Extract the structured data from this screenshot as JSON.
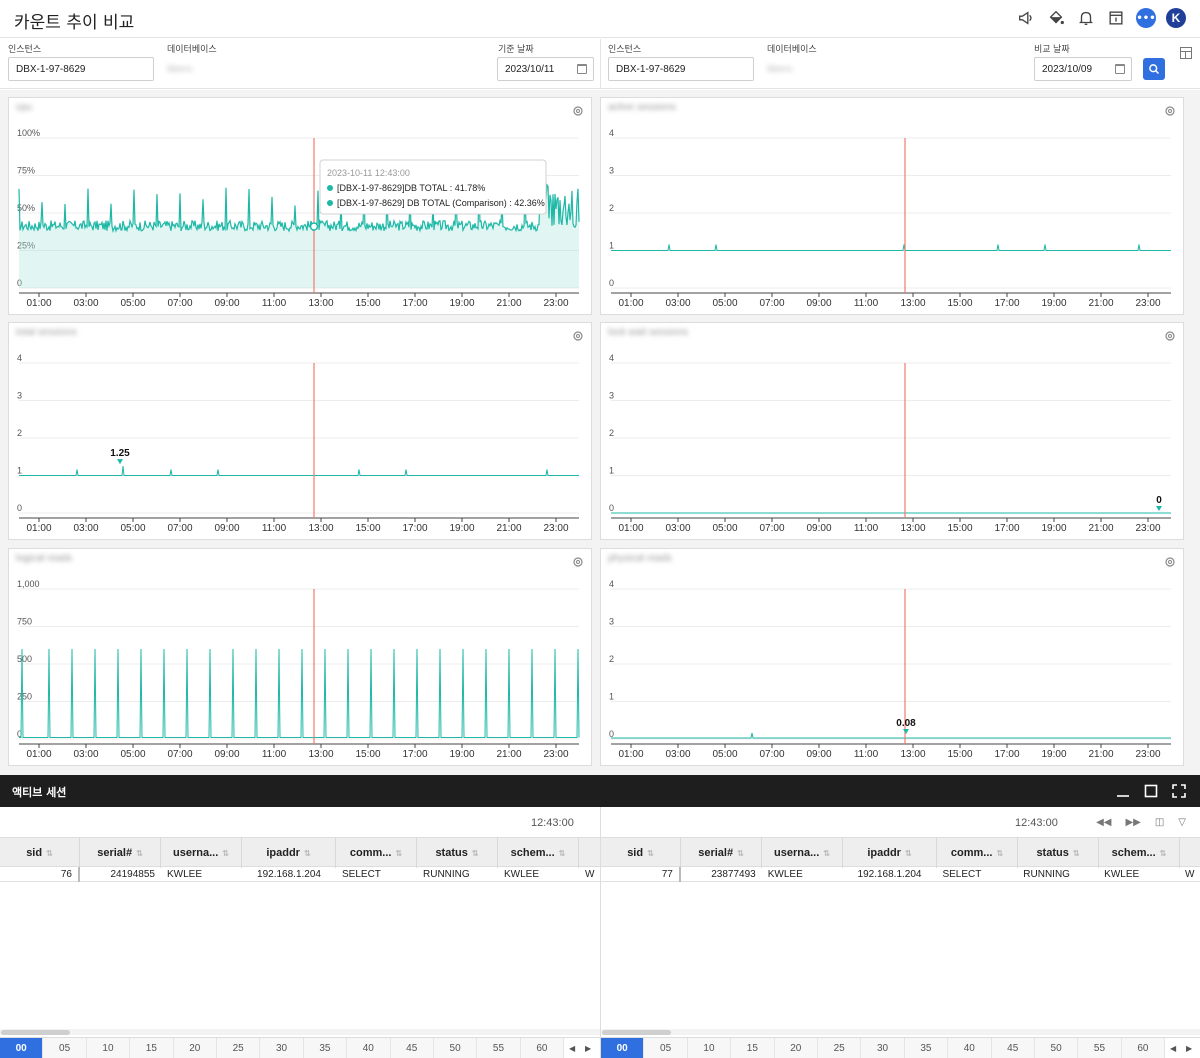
{
  "page": {
    "title": "카운트 추이 비교"
  },
  "colors": {
    "accent": "#2f6fe0",
    "series": "#1fb8a6",
    "series_light": "#a8e4dc",
    "marker": "#f47a70"
  },
  "top_icons": [
    "megaphone-icon",
    "paint-bucket-icon",
    "bell-icon",
    "info-icon",
    "chat-icon",
    "avatar"
  ],
  "avatar_letter": "K",
  "chat_glyph": "•••",
  "filters": {
    "left": {
      "instance_label": "인스턴스",
      "instance_value": "DBX-1-97-8629",
      "database_label": "데이터베이스",
      "database_value": "tibero",
      "date_label": "기준 날짜",
      "date_value": "2023/10/11"
    },
    "right": {
      "instance_label": "인스턴스",
      "instance_value": "DBX-1-97-8629",
      "database_label": "데이터베이스",
      "database_value": "tibero",
      "date_label": "비교 날짜",
      "date_value": "2023/10/09"
    }
  },
  "panels": [
    {
      "title": "cpu",
      "y_ticks": [
        "0",
        "25%",
        "50%",
        "75%",
        "100%"
      ],
      "x_ticks": [
        "01:00",
        "03:00",
        "05:00",
        "07:00",
        "09:00",
        "11:00",
        "13:00",
        "15:00",
        "17:00",
        "19:00",
        "21:00",
        "23:00"
      ]
    },
    {
      "title": "active sessions",
      "y_ticks": [
        "0",
        "1",
        "2",
        "3",
        "4"
      ],
      "x_ticks": [
        "01:00",
        "03:00",
        "05:00",
        "07:00",
        "09:00",
        "11:00",
        "13:00",
        "15:00",
        "17:00",
        "19:00",
        "21:00",
        "23:00"
      ]
    },
    {
      "title": "total sessions",
      "y_ticks": [
        "0",
        "1",
        "2",
        "3",
        "4"
      ],
      "x_ticks": [
        "01:00",
        "03:00",
        "05:00",
        "07:00",
        "09:00",
        "11:00",
        "13:00",
        "15:00",
        "17:00",
        "19:00",
        "21:00",
        "23:00"
      ],
      "annotation": "1.25"
    },
    {
      "title": "lock wait sessions",
      "y_ticks": [
        "0",
        "1",
        "2",
        "3",
        "4"
      ],
      "x_ticks": [
        "01:00",
        "03:00",
        "05:00",
        "07:00",
        "09:00",
        "11:00",
        "13:00",
        "15:00",
        "17:00",
        "19:00",
        "21:00",
        "23:00"
      ],
      "annotation": "0"
    },
    {
      "title": "logical reads",
      "y_ticks": [
        "0",
        "250",
        "500",
        "750",
        "1,000"
      ],
      "x_ticks": [
        "01:00",
        "03:00",
        "05:00",
        "07:00",
        "09:00",
        "11:00",
        "13:00",
        "15:00",
        "17:00",
        "19:00",
        "21:00",
        "23:00"
      ]
    },
    {
      "title": "physical reads",
      "y_ticks": [
        "0",
        "1",
        "2",
        "3",
        "4"
      ],
      "x_ticks": [
        "01:00",
        "03:00",
        "05:00",
        "07:00",
        "09:00",
        "11:00",
        "13:00",
        "15:00",
        "17:00",
        "19:00",
        "21:00",
        "23:00"
      ],
      "annotation": "0.08"
    }
  ],
  "tooltip": {
    "time": "2023-10-11 12:43:00",
    "line1": "[DBX-1-97-8629]DB TOTAL : 41.78%",
    "line2": "[DBX-1-97-8629] DB TOTAL (Comparison) : 42.36%"
  },
  "bottom": {
    "title": "액티브 세션",
    "left": {
      "time": "12:43:00",
      "columns": [
        "sid",
        "serial#",
        "userna...",
        "ipaddr",
        "comm...",
        "status",
        "schem..."
      ],
      "row": [
        "76",
        "24194855",
        "KWLEE",
        "192.168.1.204",
        "SELECT",
        "RUNNING",
        "KWLEE",
        "W"
      ]
    },
    "right": {
      "time": "12:43:00",
      "columns": [
        "sid",
        "serial#",
        "userna...",
        "ipaddr",
        "comm...",
        "status",
        "schem..."
      ],
      "row": [
        "77",
        "23877493",
        "KWLEE",
        "192.168.1.204",
        "SELECT",
        "RUNNING",
        "KWLEE",
        "W"
      ]
    },
    "pager": [
      "00",
      "05",
      "10",
      "15",
      "20",
      "25",
      "30",
      "35",
      "40",
      "45",
      "50",
      "55",
      "60"
    ]
  }
}
